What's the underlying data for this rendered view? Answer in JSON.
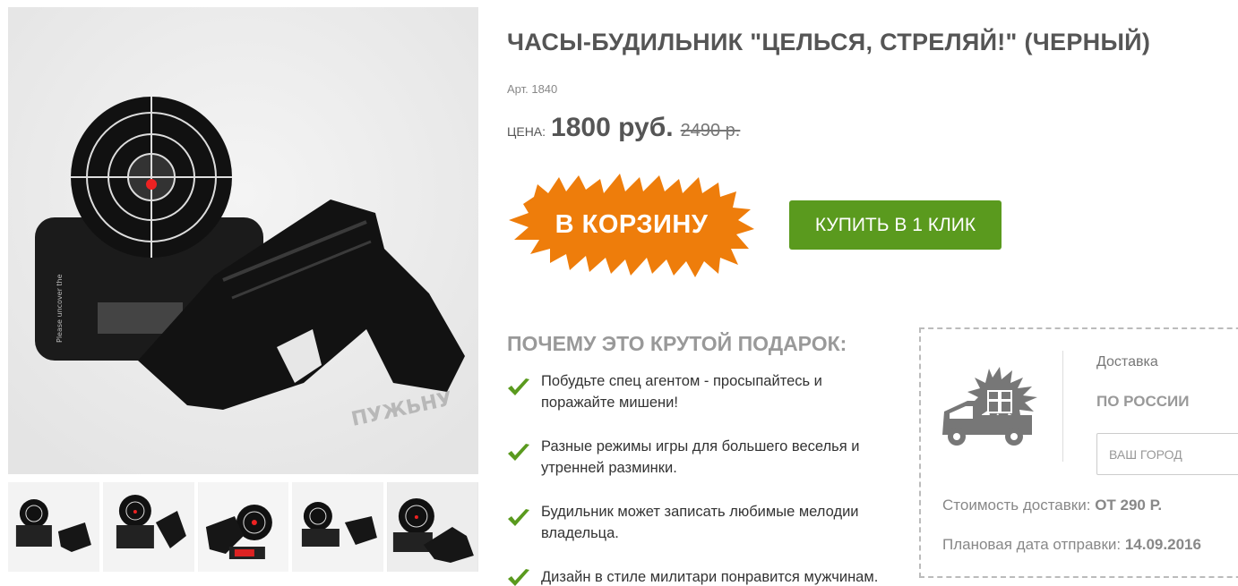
{
  "product": {
    "title": "ЧАСЫ-БУДИЛЬНИК \"ЦЕЛЬСЯ, СТРЕЛЯЙ!\" (ЧЕРНЫЙ)",
    "sku": "Арт. 1840",
    "price_label": "ЦЕНА:",
    "price": "1800 руб.",
    "old_price": "2490 р."
  },
  "actions": {
    "cart_label": "В КОРЗИНУ",
    "buy_one_click_label": "КУПИТЬ В 1 КЛИК"
  },
  "benefits": {
    "title": "ПОЧЕМУ ЭТО КРУТОЙ ПОДАРОК:",
    "items": [
      "Побудьте спец агентом - просыпайтесь и поражайте мишени!",
      "Разные режимы игры для большего веселья и утренней разминки.",
      "Будильник может записать любимые мелодии владельца.",
      "Дизайн в стиле милитари понравится мужчинам."
    ]
  },
  "delivery": {
    "label": "Доставка",
    "region": "ПО РОССИИ",
    "city_placeholder": "ВАШ ГОРОД",
    "cost_label": "Стоимость доставки:",
    "cost_value": "ОТ 290 Р.",
    "ship_label": "Плановая дата отправки:",
    "ship_value": "14.09.2016"
  },
  "gallery": {
    "thumb_count": 5,
    "active_thumb": 5
  },
  "colors": {
    "cart_splash": "#ee7d0b",
    "buy_button": "#5a9a1e",
    "check": "#5a9a1e",
    "text_muted": "#999999"
  },
  "icons": {
    "check": "check-icon",
    "truck": "gift-truck-icon"
  }
}
